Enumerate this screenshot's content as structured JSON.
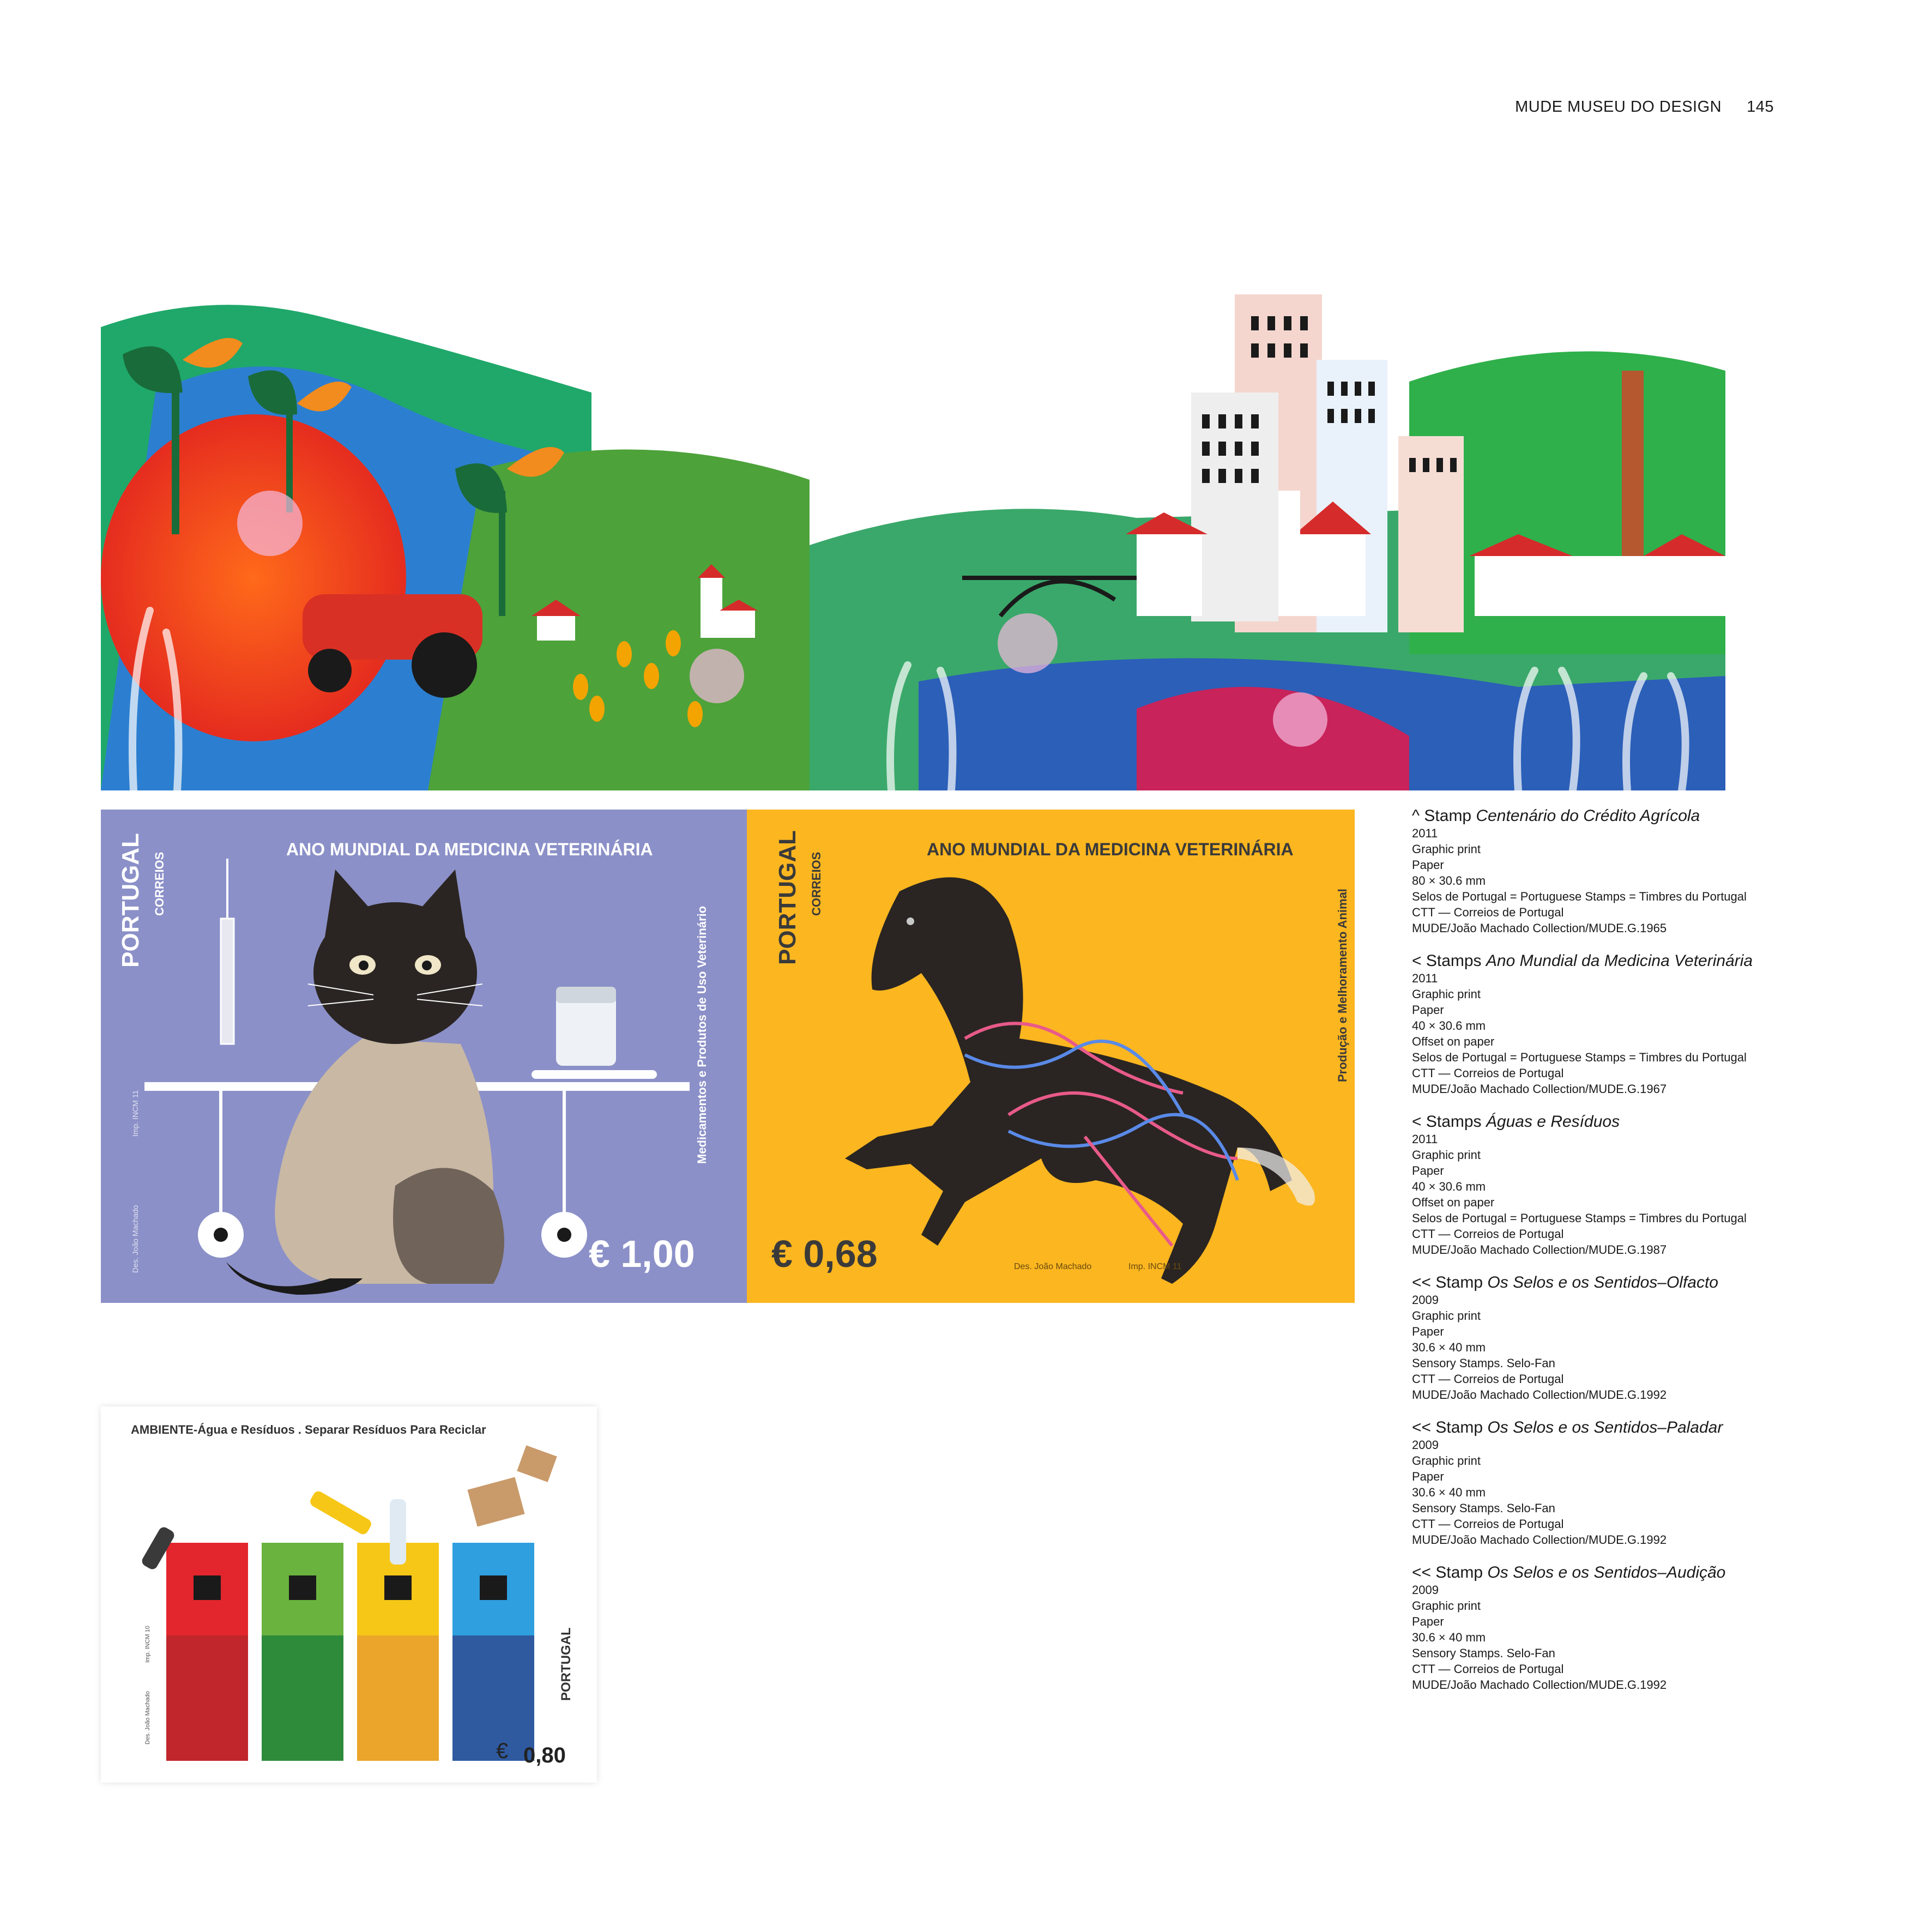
{
  "header": {
    "section": "MUDE MUSEU DO DESIGN",
    "page_number": "145"
  },
  "stamp_agricola": {
    "alt": ""
  },
  "stamp_cat": {
    "country": "PORTUGAL",
    "post": "CORREIOS",
    "title": "ANO MUNDIAL DA MEDICINA VETERINÁRIA",
    "side_text": "Medicamentos e Produtos de Uso Veterinário",
    "designer": "Des. João Machado",
    "printer": "Imp. INCM 11",
    "value": "€ 1,00"
  },
  "stamp_horse": {
    "country": "PORTUGAL",
    "post": "CORREIOS",
    "title": "ANO MUNDIAL DA MEDICINA VETERINÁRIA",
    "side_text": "Produção e Melhoramento Animal",
    "designer": "Des. João Machado",
    "printer": "Imp. INCM 11",
    "value": "€ 0,68"
  },
  "stamp_recycle": {
    "title": "AMBIENTE-Água e Resíduos . Separar Resíduos Para Reciclar",
    "country": "PORTUGAL",
    "designer": "Des. João Machado",
    "printer": "Imp. INCM 10",
    "currency": "€",
    "value": "0,80"
  },
  "captions": [
    {
      "prefix": "^ Stamp ",
      "title": "Centenário do Crédito Agrícola",
      "lines": [
        "2011",
        "Graphic print",
        "Paper",
        "80 × 30.6 mm",
        "Selos de Portugal = Portuguese Stamps = Timbres du Portugal",
        "CTT — Correios de Portugal",
        "MUDE/João Machado Collection/MUDE.G.1965"
      ]
    },
    {
      "prefix": "< Stamps ",
      "title": "Ano Mundial da Medicina Veterinária",
      "lines": [
        "2011",
        "Graphic print",
        "Paper",
        "40 × 30.6 mm",
        "Offset on paper",
        "Selos de Portugal = Portuguese Stamps = Timbres du Portugal",
        "CTT — Correios de Portugal",
        "MUDE/João Machado Collection/MUDE.G.1967"
      ]
    },
    {
      "prefix": "< Stamps ",
      "title": "Águas e Resíduos",
      "lines": [
        "2011",
        "Graphic print",
        "Paper",
        "40 × 30.6 mm",
        "Offset on paper",
        "Selos de Portugal = Portuguese Stamps = Timbres du Portugal",
        "CTT — Correios de Portugal",
        "MUDE/João Machado Collection/MUDE.G.1987"
      ]
    },
    {
      "prefix": "<< Stamp ",
      "title": "Os Selos e os Sentidos–Olfacto",
      "lines": [
        "2009",
        "Graphic print",
        "Paper",
        "30.6 × 40 mm",
        "Sensory Stamps. Selo-Fan",
        "CTT — Correios de Portugal",
        "MUDE/João Machado Collection/MUDE.G.1992"
      ]
    },
    {
      "prefix": "<< Stamp ",
      "title": "Os Selos e os Sentidos–Paladar",
      "lines": [
        "2009",
        "Graphic print",
        "Paper",
        "30.6 × 40 mm",
        "Sensory Stamps. Selo-Fan",
        "CTT — Correios de Portugal",
        "MUDE/João Machado Collection/MUDE.G.1992"
      ]
    },
    {
      "prefix": "<< Stamp ",
      "title": "Os Selos e os Sentidos–Audição",
      "lines": [
        "2009",
        "Graphic print",
        "Paper",
        "30.6 × 40 mm",
        "Sensory Stamps. Selo-Fan",
        "CTT — Correios de Portugal",
        "MUDE/João Machado Collection/MUDE.G.1992"
      ]
    }
  ]
}
